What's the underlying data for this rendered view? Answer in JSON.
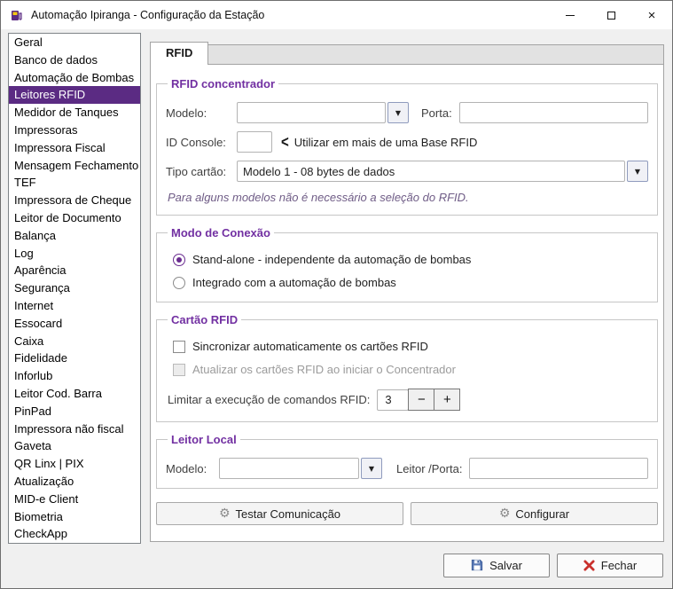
{
  "colors": {
    "accent": "#6a2c90",
    "sidebar_selected": "#5b2b83",
    "group_title": "#7230a2",
    "note_text": "#6f5c86",
    "close_red": "#c9302c",
    "save_blue": "#44609a"
  },
  "icons": {
    "minimize": "minimize-line",
    "maximize": "maximize-box",
    "close": "×",
    "dropdown": "▼",
    "chevron_left": "<",
    "minus": "−",
    "plus": "+",
    "gear": "⚙"
  },
  "window": {
    "title": "Automação Ipiranga - Configuração da Estação"
  },
  "sidebar": {
    "items": [
      {
        "label": "Geral"
      },
      {
        "label": "Banco de dados"
      },
      {
        "label": "Automação de Bombas"
      },
      {
        "label": "Leitores RFID",
        "selected": true
      },
      {
        "label": "Medidor de Tanques"
      },
      {
        "label": "Impressoras"
      },
      {
        "label": "Impressora Fiscal"
      },
      {
        "label": "Mensagem Fechamento"
      },
      {
        "label": "TEF"
      },
      {
        "label": "Impressora de Cheque"
      },
      {
        "label": "Leitor de Documento"
      },
      {
        "label": "Balança"
      },
      {
        "label": "Log"
      },
      {
        "label": "Aparência"
      },
      {
        "label": "Segurança"
      },
      {
        "label": "Internet"
      },
      {
        "label": "Essocard"
      },
      {
        "label": "Caixa"
      },
      {
        "label": "Fidelidade"
      },
      {
        "label": "Inforlub"
      },
      {
        "label": "Leitor Cod. Barra"
      },
      {
        "label": "PinPad"
      },
      {
        "label": "Impressora não fiscal"
      },
      {
        "label": "Gaveta"
      },
      {
        "label": "QR Linx | PIX"
      },
      {
        "label": "Atualização"
      },
      {
        "label": "MID-e Client"
      },
      {
        "label": "Biometria"
      },
      {
        "label": "CheckApp"
      }
    ]
  },
  "tabs": {
    "rfid": "RFID"
  },
  "groups": {
    "concentrador": {
      "title": "RFID concentrador",
      "modelo_label": "Modelo:",
      "modelo_value": "",
      "porta_label": "Porta:",
      "porta_value": "",
      "id_console_label": "ID Console:",
      "id_console_value": "",
      "id_console_hint": "Utilizar em mais de uma Base RFID",
      "tipo_cartao_label": "Tipo cartão:",
      "tipo_cartao_value": "Modelo 1 - 08 bytes de dados",
      "note": "Para alguns modelos não é necessário a seleção do RFID."
    },
    "modo_conexao": {
      "title": "Modo de Conexão",
      "options": [
        {
          "label": "Stand-alone - independente da automação de bombas",
          "selected": true
        },
        {
          "label": "Integrado com a automação de bombas",
          "selected": false
        }
      ]
    },
    "cartao_rfid": {
      "title": "Cartão RFID",
      "checkboxes": [
        {
          "label": "Sincronizar automaticamente os cartões RFID",
          "checked": false,
          "enabled": true
        },
        {
          "label": "Atualizar os cartões RFID ao iniciar o Concentrador",
          "checked": false,
          "enabled": false
        }
      ],
      "limit_label": "Limitar a execução de comandos RFID:",
      "limit_value": "3"
    },
    "leitor_local": {
      "title": "Leitor Local",
      "modelo_label": "Modelo:",
      "modelo_value": "",
      "leitor_porta_label": "Leitor /Porta:",
      "leitor_porta_value": ""
    }
  },
  "actions": {
    "testar": "Testar Comunicação",
    "configurar": "Configurar"
  },
  "footer": {
    "salvar": "Salvar",
    "fechar": "Fechar"
  }
}
